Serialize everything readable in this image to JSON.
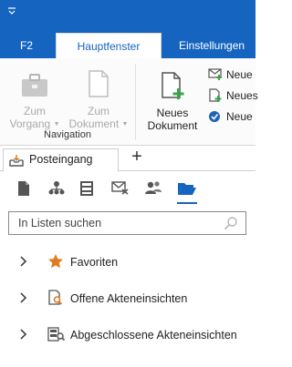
{
  "ribbon_tabs": [
    "F2",
    "Hauptfenster",
    "Einstellungen"
  ],
  "ribbon": {
    "zum_vorgang": [
      "Zum",
      "Vorgang"
    ],
    "zum_dokument": [
      "Zum",
      "Dokument"
    ],
    "group_label": "Navigation",
    "neues_dokument": [
      "Neues",
      "Dokument"
    ],
    "small_items": [
      "Neue",
      "Neues",
      "Neue"
    ]
  },
  "doc_tab": {
    "label": "Posteingang",
    "add_symbol": "+"
  },
  "search": {
    "placeholder": "In Listen suchen"
  },
  "tree": [
    {
      "label": "Favoriten",
      "icon": "star-icon"
    },
    {
      "label": "Offene Akteneinsichten",
      "icon": "file-view-icon"
    },
    {
      "label": "Abgeschlossene Akteneinsichten",
      "icon": "archive-view-icon"
    }
  ],
  "colors": {
    "accent": "#1565c0",
    "star": "#e07b23",
    "green": "#3aa34a"
  }
}
